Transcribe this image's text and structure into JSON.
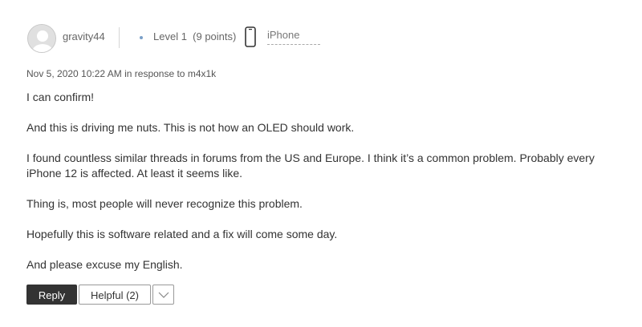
{
  "author": {
    "username": "gravity44",
    "level": "Level 1",
    "points": "(9 points)",
    "device": "iPhone"
  },
  "meta": {
    "date": "Nov 5, 2020 10:22 AM",
    "in_response_prefix": "in response to",
    "in_response_to": "m4x1k"
  },
  "body": {
    "paragraphs": [
      "I can confirm!",
      "And this is driving me nuts. This is not how an OLED should work.",
      "I found countless similar threads in forums from the US and Europe. I think it’s a common problem. Probably every iPhone 12 is affected. At least it seems like.",
      "Thing is, most people will never recognize this problem.",
      "Hopefully this is software related and a fix will come some day.",
      "And please excuse my English."
    ]
  },
  "actions": {
    "reply_label": "Reply",
    "helpful_label": "Helpful (2)"
  },
  "icons": {
    "avatar": "user-avatar-icon",
    "phone": "phone-icon",
    "more": "chevron-down-icon"
  },
  "colors": {
    "reply_bg": "#333333",
    "level_dot": "#7a9fc8",
    "text": "#333333",
    "muted": "#666666"
  }
}
